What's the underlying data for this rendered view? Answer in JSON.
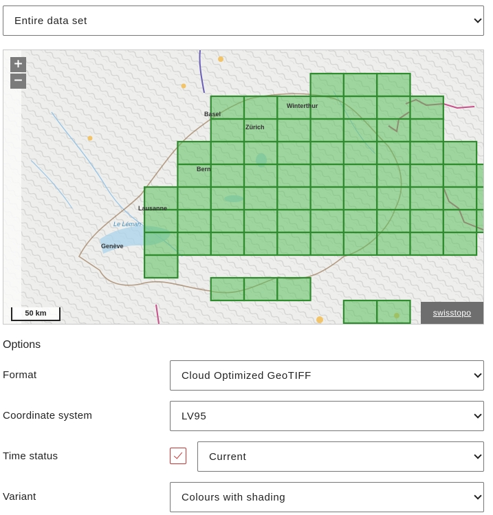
{
  "extent_select": {
    "value": "Entire data set"
  },
  "map": {
    "zoom_in": "+",
    "zoom_out": "−",
    "scale": "50 km",
    "attribution": "swisstopo",
    "cities": [
      "Basel",
      "Winterthur",
      "Zürich",
      "Bern",
      "Lausanne",
      "Genève"
    ],
    "lake_label": "Le Léman",
    "tile_fill": "#5cbf5c",
    "tile_stroke": "#2e8b2e",
    "tile_rows": [
      [
        7,
        9
      ],
      [
        4,
        10
      ],
      [
        4,
        10
      ],
      [
        3,
        11
      ],
      [
        3,
        12
      ],
      [
        2,
        12
      ],
      [
        2,
        12
      ],
      [
        2,
        11
      ],
      [
        2,
        2
      ],
      [
        4,
        6
      ],
      [
        8,
        9
      ]
    ]
  },
  "options": {
    "heading": "Options",
    "format": {
      "label": "Format",
      "value": "Cloud Optimized GeoTIFF"
    },
    "coordinate_system": {
      "label": "Coordinate system",
      "value": "LV95"
    },
    "time_status": {
      "label": "Time status",
      "value": "Current",
      "checked": true
    },
    "variant": {
      "label": "Variant",
      "value": "Colours with shading"
    }
  }
}
